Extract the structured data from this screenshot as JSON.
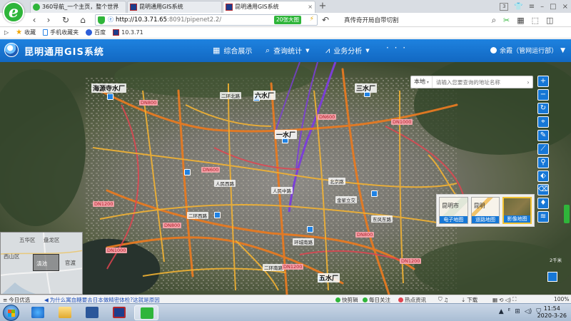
{
  "browser": {
    "tabs": [
      {
        "label": "360导航_一个主页，整个世界",
        "favicon": "360-icon",
        "active": false
      },
      {
        "label": "昆明通用GIS系统",
        "favicon": "kunming-icon",
        "active": false
      },
      {
        "label": "昆明通用GIS系统",
        "favicon": "kunming-icon",
        "active": true
      }
    ],
    "new_tab": "+",
    "tab_count": "3",
    "address": {
      "host": "http://10.3.71.65",
      "path": ":8091/pipenet2.2/",
      "badge": "20张大图"
    },
    "search_query": "真传奇开局自带切割",
    "bookmarks": [
      {
        "label": "收藏",
        "icon": "star-icon"
      },
      {
        "label": "手机收藏夹",
        "icon": "phone-icon"
      },
      {
        "label": "百度",
        "icon": "baidu-icon"
      },
      {
        "label": "10.3.71",
        "icon": "kunming-icon"
      }
    ]
  },
  "app": {
    "title": "昆明通用GIS系统",
    "menus": [
      {
        "label": "综合展示",
        "icon": "grid-icon"
      },
      {
        "label": "查询统计",
        "icon": "search-icon"
      },
      {
        "label": "业务分析",
        "icon": "chart-icon"
      }
    ],
    "more": "· · ·",
    "user": "余霞（管网运行部）"
  },
  "map": {
    "search": {
      "scope": "本地",
      "placeholder": "请输入您要查询的地址名称"
    },
    "plants": [
      "海源寺水厂",
      "六水厂",
      "三水厂",
      "一水厂",
      "五水厂"
    ],
    "district_labels": [
      "二环北路",
      "人民西路",
      "人民中路",
      "二环西路",
      "环城南路",
      "北京路",
      "金星立交",
      "二环南路",
      "东风东路"
    ],
    "dn_labels": [
      "DN800",
      "DN1000",
      "DN600",
      "DN1200",
      "DN800",
      "DN1000",
      "DN1200",
      "DN600",
      "DN800",
      "DN1200"
    ],
    "basemaps": [
      {
        "label": "电子地图",
        "preview_text": "昆明市",
        "selected": false
      },
      {
        "label": "道路地图",
        "preview_text": "昆明",
        "selected": false
      },
      {
        "label": "影像地图",
        "preview_text": "",
        "selected": true
      }
    ],
    "overview_labels": [
      "五华区",
      "盘龙区",
      "西山区",
      "官渡",
      "滇池"
    ],
    "scale": "2千米",
    "colors": {
      "main_pipe": "#e67a22",
      "pipe": "#f2b233",
      "river": "#7b3fd6",
      "station": "#1f82e4"
    }
  },
  "statusbar": {
    "left": "今日优选",
    "news": "为什么寓血糖要去日本做精密体检?这就是原因",
    "items": [
      "快剪辑",
      "每日关注",
      "热点资讯"
    ],
    "download": "下载",
    "zoom": "100%"
  },
  "taskbar": {
    "time": "11:54",
    "date": "2020-3-26"
  }
}
